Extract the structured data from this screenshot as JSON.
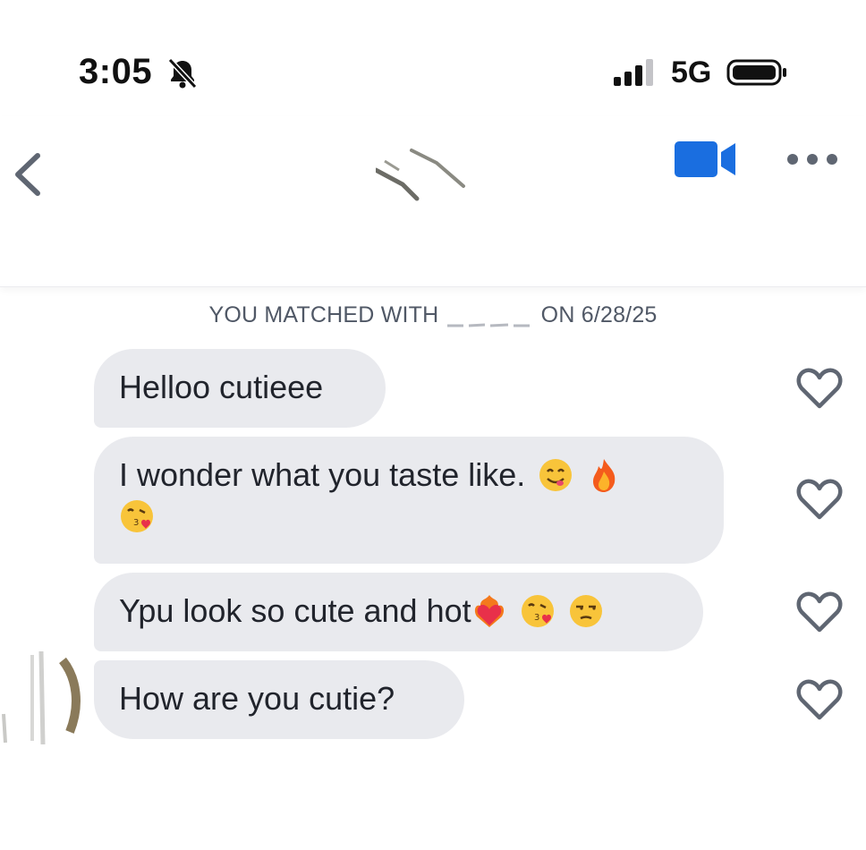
{
  "status_bar": {
    "time": "3:05",
    "network": "5G",
    "icons": [
      "bell-slash-icon",
      "signal-icon",
      "battery-icon"
    ]
  },
  "header": {
    "icons": [
      "back-chevron-icon",
      "video-call-icon",
      "more-options-icon"
    ],
    "accent_color": "#1a6ee0"
  },
  "match_notice": {
    "prefix": "YOU MATCHED WITH",
    "suffix": "ON 6/28/25"
  },
  "messages": [
    {
      "text": "Helloo cutieee",
      "emojis": []
    },
    {
      "text": "I wonder what you taste like.",
      "emojis": [
        "smiling-face-savoring-food-emoji",
        "fire-emoji",
        "face-blowing-kiss-emoji"
      ]
    },
    {
      "text": "Ypu look so cute and hot",
      "emojis": [
        "heart-on-fire-emoji",
        "face-blowing-kiss-emoji",
        "unamused-face-emoji"
      ]
    },
    {
      "text": "How are you cutie?",
      "emojis": []
    }
  ],
  "colors": {
    "bubble": "#e9eaee",
    "text": "#21242c",
    "icon_gray": "#5f6672"
  }
}
